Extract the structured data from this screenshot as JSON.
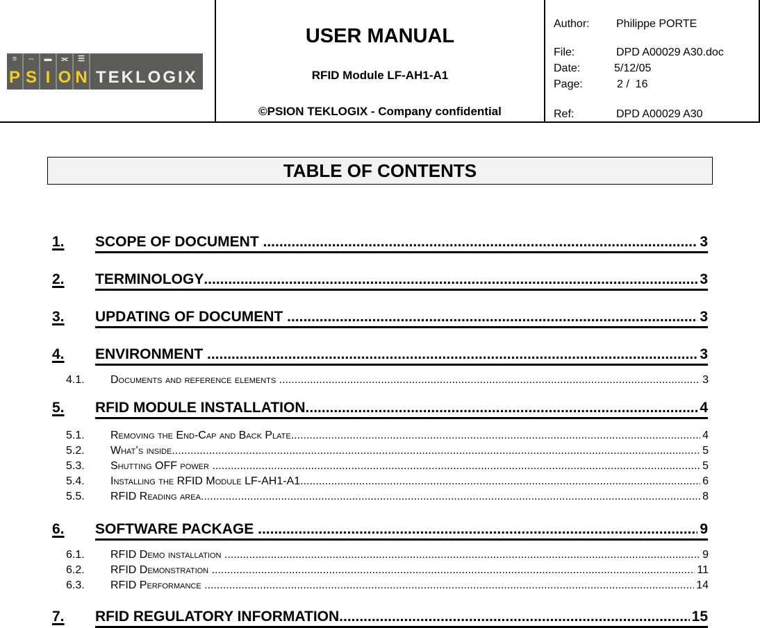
{
  "header": {
    "logo": {
      "blocks": [
        {
          "glyph": "≡",
          "letter": "P"
        },
        {
          "glyph": "⇔",
          "letter": "S"
        },
        {
          "glyph": "▬",
          "letter": "I"
        },
        {
          "glyph": "⫘",
          "letter": "O"
        },
        {
          "glyph": "☰",
          "letter": "N"
        }
      ],
      "wordmark": "TEKLOGIX"
    },
    "title": "USER MANUAL",
    "subtitle": "RFID Module LF-AH1-A1",
    "copyright": "©PSION TEKLOGIX - Company confidential",
    "meta": {
      "author_label": "Author:",
      "author": "Philippe PORTE",
      "file_label": "File:",
      "file": "DPD A00029 A30.doc",
      "date_label": "Date:",
      "date": "5/12/05",
      "page_label": "Page:",
      "page": "2 /  16",
      "ref_label": "Ref:",
      "ref": "DPD A00029 A30"
    }
  },
  "toc": {
    "title": "TABLE OF CONTENTS",
    "entries": [
      {
        "level": 1,
        "num": "1.",
        "label": "SCOPE OF DOCUMENT ",
        "page": "3"
      },
      {
        "level": 1,
        "num": "2.",
        "label": "TERMINOLOGY",
        "page": "3"
      },
      {
        "level": 1,
        "num": "3.",
        "label": "UPDATING OF DOCUMENT ",
        "page": "3"
      },
      {
        "level": 1,
        "num": "4.",
        "label": "ENVIRONMENT ",
        "page": "3"
      },
      {
        "level": 2,
        "num": "4.1.",
        "label": "Documents and reference elements ",
        "page": "3"
      },
      {
        "level": 1,
        "num": "5.",
        "label": "RFID MODULE INSTALLATION",
        "page": "4"
      },
      {
        "level": 2,
        "num": "5.1.",
        "label": "Removing the End-Cap and Back Plate",
        "page": "4"
      },
      {
        "level": 2,
        "num": "5.2.",
        "label": "What’s inside",
        "page": "5"
      },
      {
        "level": 2,
        "num": "5.3.",
        "label": "Shutting OFF power ",
        "page": "5"
      },
      {
        "level": 2,
        "num": "5.4.",
        "label": "Installing the RFID Module LF-AH1-A1",
        "page": "6"
      },
      {
        "level": 2,
        "num": "5.5.",
        "label": "RFID Reading area",
        "page": "8"
      },
      {
        "level": 1,
        "num": "6.",
        "label": "SOFTWARE PACKAGE ",
        "page": "9"
      },
      {
        "level": 2,
        "num": "6.1.",
        "label": "RFID Demo installation ",
        "page": "9"
      },
      {
        "level": 2,
        "num": "6.2.",
        "label": "RFID Demonstration ",
        "page": "11"
      },
      {
        "level": 2,
        "num": "6.3.",
        "label": "RFID Performance ",
        "page": "14"
      },
      {
        "level": 1,
        "num": "7.",
        "label": "RFID REGULATORY INFORMATION",
        "page": "15"
      }
    ]
  }
}
